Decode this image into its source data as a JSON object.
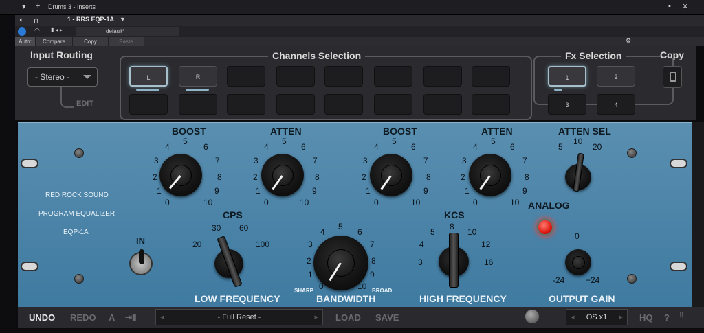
{
  "window": {
    "title": "Drums 3 - Inserts"
  },
  "host": {
    "plugin_select": "1 - RRS EQP-1A",
    "preset_name": "default*",
    "buttons": {
      "auto_off": "Auto: Off",
      "compare": "Compare",
      "copy": "Copy",
      "paste": "Paste"
    }
  },
  "router": {
    "input_routing_title": "Input Routing",
    "input_routing_value": "- Stereo -",
    "edit_label": "EDIT",
    "channels_title": "Channels Selection",
    "channels": [
      "L",
      "R",
      "",
      "",
      "",
      "",
      "",
      "",
      "",
      "",
      "",
      "",
      "",
      "",
      "",
      ""
    ],
    "fx_title": "Fx Selection",
    "fx": [
      "1",
      "2",
      "3",
      "4"
    ],
    "copy_title": "Copy"
  },
  "eq": {
    "brand_line1": "RED ROCK SOUND",
    "brand_line2": "PROGRAM EQUALIZER",
    "brand_line3": "EQP-1A",
    "in_label": "IN",
    "low_boost_label": "BOOST",
    "low_atten_label": "ATTEN",
    "high_boost_label": "BOOST",
    "high_atten_label": "ATTEN",
    "atten_sel_label": "ATTEN SEL",
    "atten_sel_values": [
      "5",
      "10",
      "20"
    ],
    "cps_label": "CPS",
    "cps_values": [
      "20",
      "30",
      "60",
      "100"
    ],
    "low_frequency_label": "LOW FREQUENCY",
    "bandwidth_label": "BANDWIDTH",
    "bandwidth_sharp": "SHARP",
    "bandwidth_broad": "BROAD",
    "kcs_label": "KCS",
    "kcs_values": [
      "3",
      "4",
      "5",
      "8",
      "10",
      "12",
      "16"
    ],
    "high_frequency_label": "HIGH FREQUENCY",
    "analog_label": "ANALOG",
    "output_gain_label": "OUTPUT GAIN",
    "output_gain_values": [
      "0",
      "-24",
      "+24"
    ],
    "knob_scale": [
      "0",
      "1",
      "2",
      "3",
      "4",
      "5",
      "6",
      "7",
      "8",
      "9",
      "10"
    ]
  },
  "bottom": {
    "undo": "UNDO",
    "redo": "REDO",
    "a_label": "A",
    "preset": "- Full Reset -",
    "load": "LOAD",
    "save": "SAVE",
    "oversampling": "OS x1",
    "hq": "HQ",
    "help": "?"
  },
  "colors": {
    "panel_blue": "#4f86aa",
    "led_red": "#e01b14",
    "accent": "#2a7bd8"
  }
}
